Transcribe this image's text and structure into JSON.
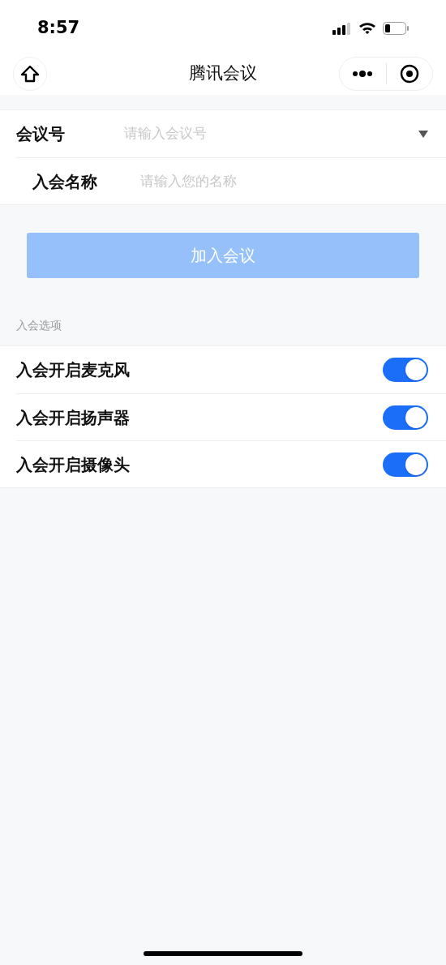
{
  "status_bar": {
    "time": "8:57"
  },
  "nav_bar": {
    "title": "腾讯会议"
  },
  "form": {
    "fields": [
      {
        "label": "会议号",
        "placeholder": "请输入会议号",
        "kind": "dropdown"
      },
      {
        "label": "入会名称",
        "placeholder": "请输入您的名称",
        "kind": "text"
      }
    ]
  },
  "join_button": {
    "label": "加入会议",
    "disabled": true
  },
  "options": {
    "heading": "入会选项",
    "items": [
      {
        "label": "入会开启麦克风",
        "on": true
      },
      {
        "label": "入会开启扬声器",
        "on": true
      },
      {
        "label": "入会开启摄像头",
        "on": true
      }
    ]
  }
}
